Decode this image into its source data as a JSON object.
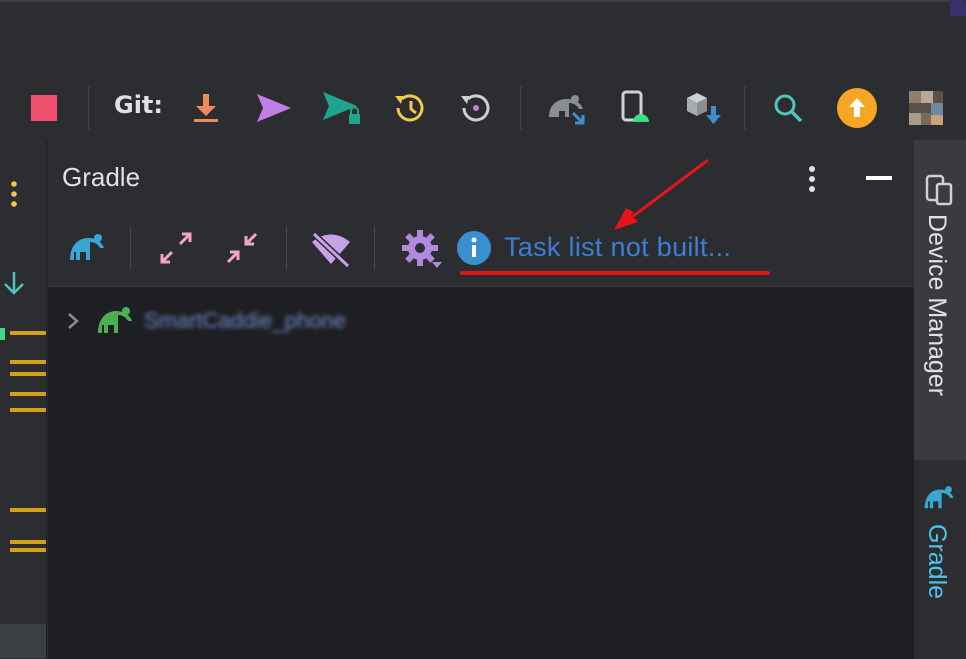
{
  "toolbar": {
    "git_label": "Git:",
    "buttons": [
      {
        "icon": "stop-icon",
        "color": "#f0506e"
      },
      {
        "icon": "git-update-icon",
        "color": "#f08a5d"
      },
      {
        "icon": "git-push-icon",
        "color": "#c07ee8"
      },
      {
        "icon": "git-push-locked-icon",
        "color": "#1fa58f"
      },
      {
        "icon": "history-icon",
        "color": "#f2c94c"
      },
      {
        "icon": "rollback-icon",
        "color": "#ced0d6"
      },
      {
        "icon": "gradle-sync-icon",
        "color": "#8a8d93"
      },
      {
        "icon": "device-manager-icon",
        "color": "#3ddc84"
      },
      {
        "icon": "sdk-manager-icon",
        "color": "#3d8fd6"
      },
      {
        "icon": "search-icon",
        "color": "#4fc3c0"
      },
      {
        "icon": "update-icon",
        "color": "#f5a623"
      },
      {
        "icon": "avatar",
        "color": "#7a6a5e"
      }
    ]
  },
  "panel": {
    "title": "Gradle",
    "task_link": "Task list not built...",
    "tree": {
      "project_name": "SmartCaddie_phone"
    }
  },
  "right_stripe": {
    "device_manager_label": "Device Manager",
    "gradle_label": "Gradle"
  },
  "colors": {
    "accent_link": "#3d7dd6",
    "annotation_red": "#e5141b",
    "bookmark_yellow": "#d4a017"
  }
}
